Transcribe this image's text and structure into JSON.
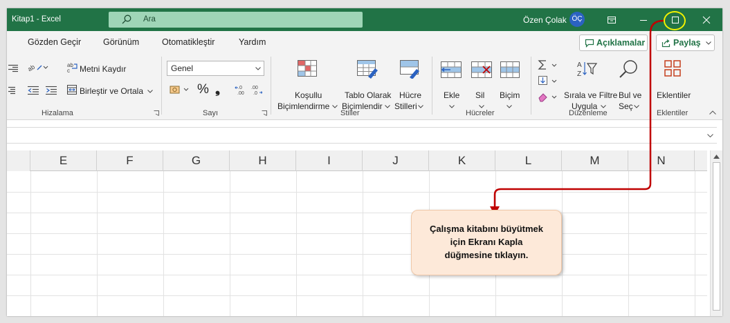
{
  "window": {
    "title": "Kitap1  -  Excel",
    "search_placeholder": "Ara",
    "user_name": "Özen Çolak",
    "user_initials": "ÖÇ"
  },
  "menu": {
    "tabs": [
      "Gözden Geçir",
      "Görünüm",
      "Otomatikleştir",
      "Yardım"
    ],
    "comments_label": "Açıklamalar",
    "share_label": "Paylaş"
  },
  "ribbon": {
    "alignment": {
      "wrap_text": "Metni Kaydır",
      "merge_center": "Birleştir ve Ortala",
      "group_label": "Hizalama"
    },
    "number": {
      "format_value": "Genel",
      "percent": "%",
      "comma": "❟",
      "group_label": "Sayı"
    },
    "styles": {
      "conditional_line1": "Koşullu",
      "conditional_line2": "Biçimlendirme",
      "table_line1": "Tablo Olarak",
      "table_line2": "Biçimlendir",
      "cell_line1": "Hücre",
      "cell_line2": "Stilleri",
      "group_label": "Stiller"
    },
    "cells": {
      "insert": "Ekle",
      "delete": "Sil",
      "format": "Biçim",
      "group_label": "Hücreler"
    },
    "editing": {
      "sort_line1": "Sırala ve Filtre",
      "sort_line2": "Uygula",
      "find_line1": "Bul ve",
      "find_line2": "Seç",
      "group_label": "Düzenleme"
    },
    "addins": {
      "label": "Eklentiler",
      "group_label": "Eklentiler"
    }
  },
  "grid": {
    "columns": [
      "E",
      "F",
      "G",
      "H",
      "I",
      "J",
      "K",
      "L",
      "M",
      "N"
    ]
  },
  "callout": {
    "line1": "Çalışma kitabını büyütmek",
    "line2": "için Ekranı Kapla",
    "line3": "düğmesine tıklayın."
  },
  "colors": {
    "title_bar": "#217346",
    "callout_bg": "#fde9d9",
    "arrow": "#c00000",
    "highlight": "#f2f200"
  }
}
